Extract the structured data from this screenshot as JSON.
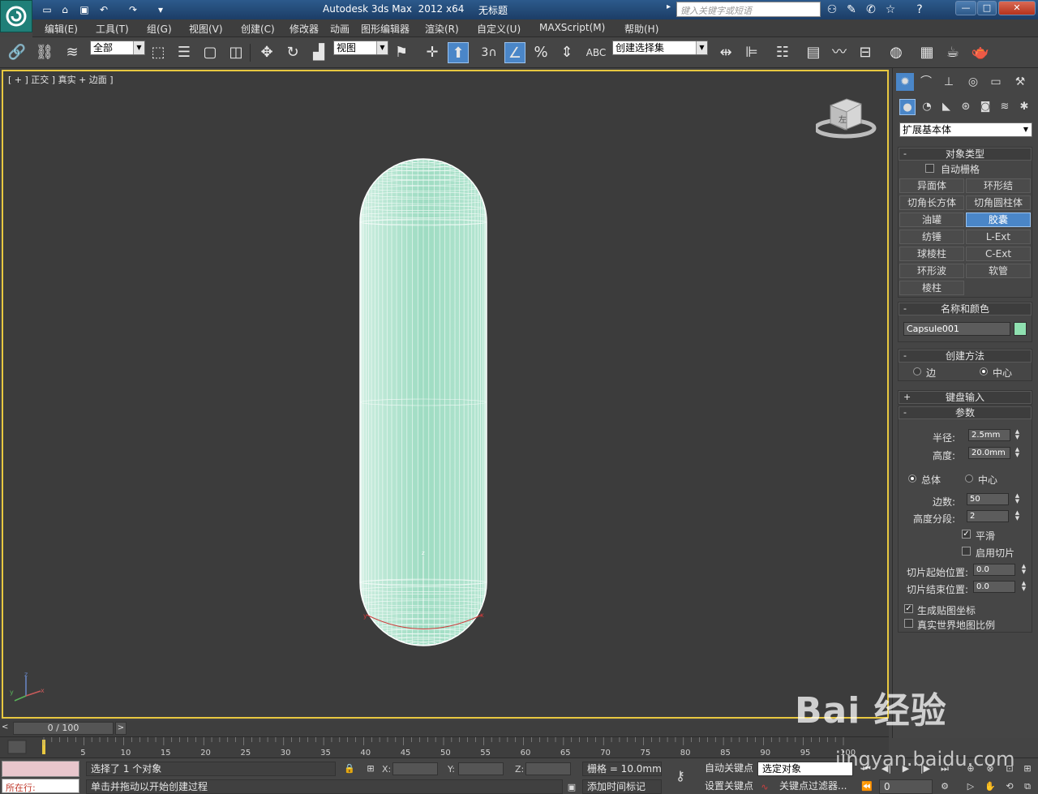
{
  "window": {
    "title": "Autodesk 3ds Max  2012 x64",
    "document": "无标题",
    "search_placeholder": "键入关键字或短语",
    "controls": [
      "—",
      "□",
      "✕"
    ]
  },
  "menu": [
    "编辑(E)",
    "工具(T)",
    "组(G)",
    "视图(V)",
    "创建(C)",
    "修改器",
    "动画",
    "图形编辑器",
    "渲染(R)",
    "自定义(U)",
    "MAXScript(M)",
    "帮助(H)"
  ],
  "toolbar": {
    "selection_filter": "全部",
    "reference_coord": "视图",
    "named_selection": "创建选择集",
    "snap_value": "3"
  },
  "viewport": {
    "label": "[ + ] 正交 ] 真实 + 边面 ]",
    "viewcube_label": "左",
    "axes": {
      "x": "x",
      "y": "y",
      "z": "z"
    },
    "object_color": "#9ee0c0"
  },
  "command_panel": {
    "category": "扩展基本体",
    "object_type": {
      "title": "对象类型",
      "autogrid_label": "自动栅格",
      "buttons": [
        "异面体",
        "环形结",
        "切角长方体",
        "切角圆柱体",
        "油罐",
        "胶囊",
        "纺锤",
        "L-Ext",
        "球棱柱",
        "C-Ext",
        "环形波",
        "软管",
        "棱柱"
      ],
      "active": "胶囊"
    },
    "name_color": {
      "title": "名称和颜色",
      "name": "Capsule001",
      "color": "#8fe0b0"
    },
    "creation_method": {
      "title": "创建方法",
      "options": [
        "边",
        "中心"
      ],
      "selected": "中心"
    },
    "keyboard_entry": {
      "title": "键盘输入"
    },
    "parameters": {
      "title": "参数",
      "radius_label": "半径:",
      "radius": "2.5mm",
      "height_label": "高度:",
      "height": "20.0mm",
      "height_mode": [
        "总体",
        "中心"
      ],
      "height_mode_selected": "总体",
      "sides_label": "边数:",
      "sides": "50",
      "height_segs_label": "高度分段:",
      "height_segs": "2",
      "smooth_label": "平滑",
      "smooth": true,
      "slice_on_label": "启用切片",
      "slice_on": false,
      "slice_from_label": "切片起始位置:",
      "slice_from": "0.0",
      "slice_to_label": "切片结束位置:",
      "slice_to": "0.0",
      "gen_map_label": "生成贴图坐标",
      "gen_map": true,
      "real_world_label": "真实世界地图比例",
      "real_world": false
    }
  },
  "timeline": {
    "frame_display": "0 / 100",
    "ticks": [
      "5",
      "10",
      "15",
      "20",
      "25",
      "30",
      "35",
      "40",
      "45",
      "50",
      "55",
      "60",
      "65",
      "70",
      "75",
      "80",
      "85",
      "90",
      "95",
      "100"
    ]
  },
  "status": {
    "listener_text": "所在行:",
    "selection_info": "选择了 1 个对象",
    "prompt": "单击并拖动以开始创建过程",
    "x_label": "X:",
    "y_label": "Y:",
    "z_label": "Z:",
    "grid": "栅格 = 10.0mm",
    "auto_key": "自动关键点",
    "set_key": "设置关键点",
    "key_filter_select": "选定对象",
    "key_filters": "关键点过滤器...",
    "add_time_tag": "添加时间标记",
    "current_frame": "0"
  },
  "watermark": {
    "text": "Bai 经验",
    "url": "jingyan.baidu.com"
  }
}
